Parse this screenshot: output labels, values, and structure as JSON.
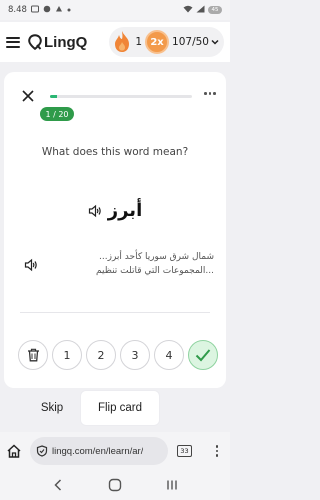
{
  "status_bar": {
    "time": "8.48",
    "battery": "45"
  },
  "header": {
    "logo_text": "LingQ",
    "streak": "1",
    "multiplier": "2x",
    "progress": "107/50"
  },
  "card": {
    "counter": "1 / 20",
    "progress_fraction": 0.05,
    "question": "What does this word mean?",
    "term": "أبرز",
    "example_line1": "شمال شرق سوريا كأحد أبرز...",
    "example_line2": "...المجموعات التي قاتلت تنظيم",
    "ratings": [
      "1",
      "2",
      "3",
      "4"
    ]
  },
  "actions": {
    "skip": "Skip",
    "flip": "Flip card"
  },
  "browser": {
    "url": "lingq.com/en/learn/ar/",
    "tabs_count": "33"
  },
  "colors": {
    "accent_green": "#2bb673",
    "pill_green": "#2f9b4a",
    "multiplier_orange": "#f39a4a"
  }
}
